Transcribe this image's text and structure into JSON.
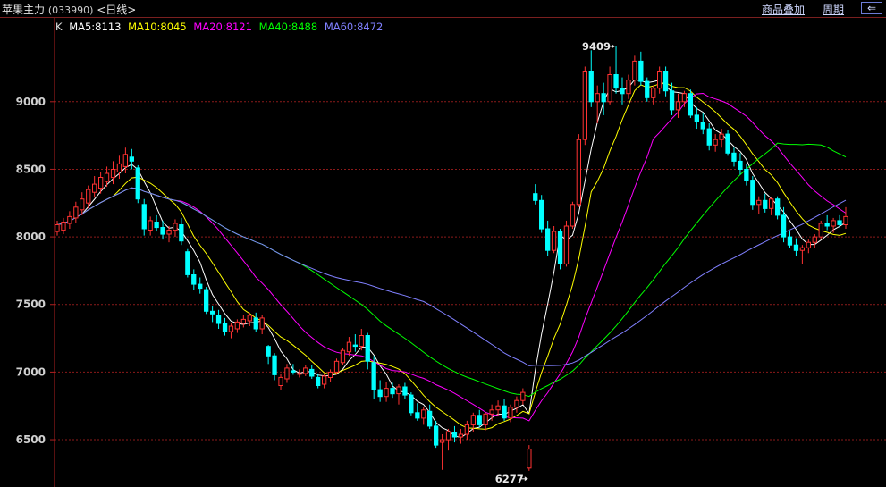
{
  "header": {
    "title": "苹果主力",
    "code": "(033990)",
    "period": "<日线>",
    "overlay_label": "商品叠加",
    "period_label": "周期",
    "back_label": "⇐"
  },
  "legend": {
    "k_label": "K",
    "items": [
      {
        "label": "MA5:8113",
        "color": "#ffffff"
      },
      {
        "label": "MA10:8045",
        "color": "#ffff00"
      },
      {
        "label": "MA20:8121",
        "color": "#ff00ff"
      },
      {
        "label": "MA40:8488",
        "color": "#00ff00"
      },
      {
        "label": "MA60:8472",
        "color": "#8080ff"
      }
    ]
  },
  "colors": {
    "up": "#ff3232",
    "down": "#00ffff",
    "grid": "#8b1a1a",
    "axis": "#b02020",
    "axis_text": "#d0d0d0"
  },
  "chart_data": {
    "type": "candlestick",
    "y_ticks": [
      6500,
      7000,
      7500,
      8000,
      8500,
      9000
    ],
    "ylim": [
      6150,
      9620
    ],
    "annotations": {
      "max_label": "9409",
      "max_value": 9409,
      "min_label": "6277",
      "min_value": 6277
    },
    "ohlc": [
      [
        8040,
        8120,
        8010,
        8090
      ],
      [
        8050,
        8140,
        8020,
        8110
      ],
      [
        8100,
        8190,
        8060,
        8150
      ],
      [
        8140,
        8260,
        8100,
        8220
      ],
      [
        8200,
        8330,
        8160,
        8280
      ],
      [
        8250,
        8380,
        8210,
        8350
      ],
      [
        8330,
        8450,
        8290,
        8390
      ],
      [
        8360,
        8480,
        8320,
        8440
      ],
      [
        8410,
        8520,
        8370,
        8470
      ],
      [
        8440,
        8560,
        8390,
        8500
      ],
      [
        8480,
        8600,
        8430,
        8540
      ],
      [
        8520,
        8660,
        8470,
        8610
      ],
      [
        8590,
        8650,
        8500,
        8560
      ],
      [
        8510,
        8530,
        8250,
        8280
      ],
      [
        8240,
        8280,
        8010,
        8060
      ],
      [
        8050,
        8150,
        8010,
        8120
      ],
      [
        8110,
        8160,
        8040,
        8070
      ],
      [
        8070,
        8120,
        7980,
        8020
      ],
      [
        8020,
        8080,
        7960,
        8050
      ],
      [
        8050,
        8130,
        8000,
        8100
      ],
      [
        8090,
        8140,
        7940,
        7970
      ],
      [
        7890,
        7910,
        7700,
        7720
      ],
      [
        7720,
        7760,
        7610,
        7650
      ],
      [
        7650,
        7700,
        7580,
        7620
      ],
      [
        7610,
        7630,
        7430,
        7450
      ],
      [
        7450,
        7490,
        7370,
        7430
      ],
      [
        7420,
        7460,
        7320,
        7360
      ],
      [
        7360,
        7400,
        7270,
        7300
      ],
      [
        7300,
        7360,
        7250,
        7340
      ],
      [
        7320,
        7390,
        7290,
        7370
      ],
      [
        7360,
        7420,
        7330,
        7390
      ],
      [
        7380,
        7440,
        7340,
        7420
      ],
      [
        7400,
        7440,
        7300,
        7320
      ],
      [
        7320,
        7420,
        7280,
        7400
      ],
      [
        7190,
        7200,
        7060,
        7120
      ],
      [
        7120,
        7140,
        6940,
        6980
      ],
      [
        6900,
        6990,
        6870,
        6960
      ],
      [
        6950,
        7060,
        6920,
        7030
      ],
      [
        7010,
        7060,
        6980,
        7000
      ],
      [
        6990,
        7020,
        6960,
        6990
      ],
      [
        6990,
        7050,
        6970,
        7030
      ],
      [
        7020,
        7050,
        6950,
        6970
      ],
      [
        6960,
        6990,
        6880,
        6900
      ],
      [
        6910,
        6990,
        6880,
        6970
      ],
      [
        6960,
        7020,
        6930,
        7000
      ],
      [
        7000,
        7100,
        6980,
        7080
      ],
      [
        7070,
        7180,
        7050,
        7160
      ],
      [
        7150,
        7260,
        7120,
        7220
      ],
      [
        7200,
        7280,
        7150,
        7190
      ],
      [
        7190,
        7320,
        7160,
        7270
      ],
      [
        7270,
        7290,
        7020,
        7080
      ],
      [
        7070,
        7120,
        6800,
        6870
      ],
      [
        6870,
        6940,
        6780,
        6820
      ],
      [
        6820,
        6930,
        6780,
        6880
      ],
      [
        6880,
        6920,
        6810,
        6840
      ],
      [
        6840,
        6910,
        6760,
        6890
      ],
      [
        6890,
        6920,
        6800,
        6830
      ],
      [
        6830,
        6850,
        6680,
        6700
      ],
      [
        6700,
        6770,
        6640,
        6660
      ],
      [
        6660,
        6740,
        6610,
        6720
      ],
      [
        6710,
        6760,
        6580,
        6600
      ],
      [
        6600,
        6640,
        6440,
        6460
      ],
      [
        6480,
        6540,
        6277,
        6500
      ],
      [
        6500,
        6580,
        6420,
        6560
      ],
      [
        6550,
        6600,
        6480,
        6520
      ],
      [
        6520,
        6580,
        6470,
        6540
      ],
      [
        6540,
        6640,
        6500,
        6610
      ],
      [
        6610,
        6700,
        6560,
        6680
      ],
      [
        6680,
        6720,
        6590,
        6610
      ],
      [
        6610,
        6700,
        6570,
        6690
      ],
      [
        6690,
        6760,
        6640,
        6720
      ],
      [
        6720,
        6790,
        6680,
        6750
      ],
      [
        6750,
        6800,
        6640,
        6660
      ],
      [
        6660,
        6760,
        6630,
        6740
      ],
      [
        6740,
        6820,
        6700,
        6790
      ],
      [
        6790,
        6880,
        6760,
        6850
      ],
      [
        6290,
        6460,
        6270,
        6430
      ],
      [
        8320,
        8390,
        8240,
        8270
      ],
      [
        8270,
        8310,
        8030,
        8060
      ],
      [
        8060,
        8120,
        7860,
        7900
      ],
      [
        7900,
        8080,
        7880,
        8040
      ],
      [
        8040,
        8060,
        7760,
        7800
      ],
      [
        7800,
        8120,
        7780,
        8080
      ],
      [
        8080,
        8260,
        8060,
        8240
      ],
      [
        8240,
        8760,
        8220,
        8720
      ],
      [
        8720,
        9260,
        8680,
        9220
      ],
      [
        9220,
        9380,
        8960,
        9000
      ],
      [
        9000,
        9120,
        8840,
        9060
      ],
      [
        9060,
        9140,
        8900,
        9000
      ],
      [
        9000,
        9260,
        8980,
        9200
      ],
      [
        9200,
        9409,
        9060,
        9100
      ],
      [
        9100,
        9180,
        8980,
        9060
      ],
      [
        9060,
        9200,
        9020,
        9160
      ],
      [
        9160,
        9340,
        9120,
        9300
      ],
      [
        9300,
        9370,
        9120,
        9150
      ],
      [
        9150,
        9180,
        9000,
        9030
      ],
      [
        9030,
        9120,
        8980,
        9100
      ],
      [
        9100,
        9260,
        9060,
        9220
      ],
      [
        9220,
        9260,
        9040,
        9080
      ],
      [
        9080,
        9140,
        8900,
        8940
      ],
      [
        8940,
        9060,
        8880,
        9000
      ],
      [
        9000,
        9080,
        8960,
        9060
      ],
      [
        9060,
        9090,
        8880,
        8900
      ],
      [
        8900,
        8960,
        8800,
        8850
      ],
      [
        8850,
        8920,
        8760,
        8800
      ],
      [
        8800,
        8840,
        8640,
        8680
      ],
      [
        8680,
        8760,
        8630,
        8720
      ],
      [
        8720,
        8800,
        8660,
        8760
      ],
      [
        8760,
        8790,
        8600,
        8620
      ],
      [
        8620,
        8660,
        8520,
        8560
      ],
      [
        8560,
        8620,
        8460,
        8500
      ],
      [
        8500,
        8540,
        8380,
        8420
      ],
      [
        8420,
        8450,
        8200,
        8240
      ],
      [
        8240,
        8300,
        8170,
        8270
      ],
      [
        8270,
        8320,
        8180,
        8210
      ],
      [
        8210,
        8290,
        8160,
        8280
      ],
      [
        8280,
        8300,
        8130,
        8160
      ],
      [
        8160,
        8220,
        7960,
        8000
      ],
      [
        8000,
        8040,
        7920,
        7940
      ],
      [
        7940,
        7990,
        7860,
        7900
      ],
      [
        7900,
        7940,
        7800,
        7920
      ],
      [
        7920,
        7980,
        7880,
        7960
      ],
      [
        7960,
        8020,
        7920,
        8000
      ],
      [
        8000,
        8120,
        7980,
        8100
      ],
      [
        8100,
        8160,
        8050,
        8080
      ],
      [
        8080,
        8140,
        8030,
        8120
      ],
      [
        8120,
        8160,
        8070,
        8090
      ],
      [
        8090,
        8220,
        8060,
        8150
      ]
    ]
  }
}
